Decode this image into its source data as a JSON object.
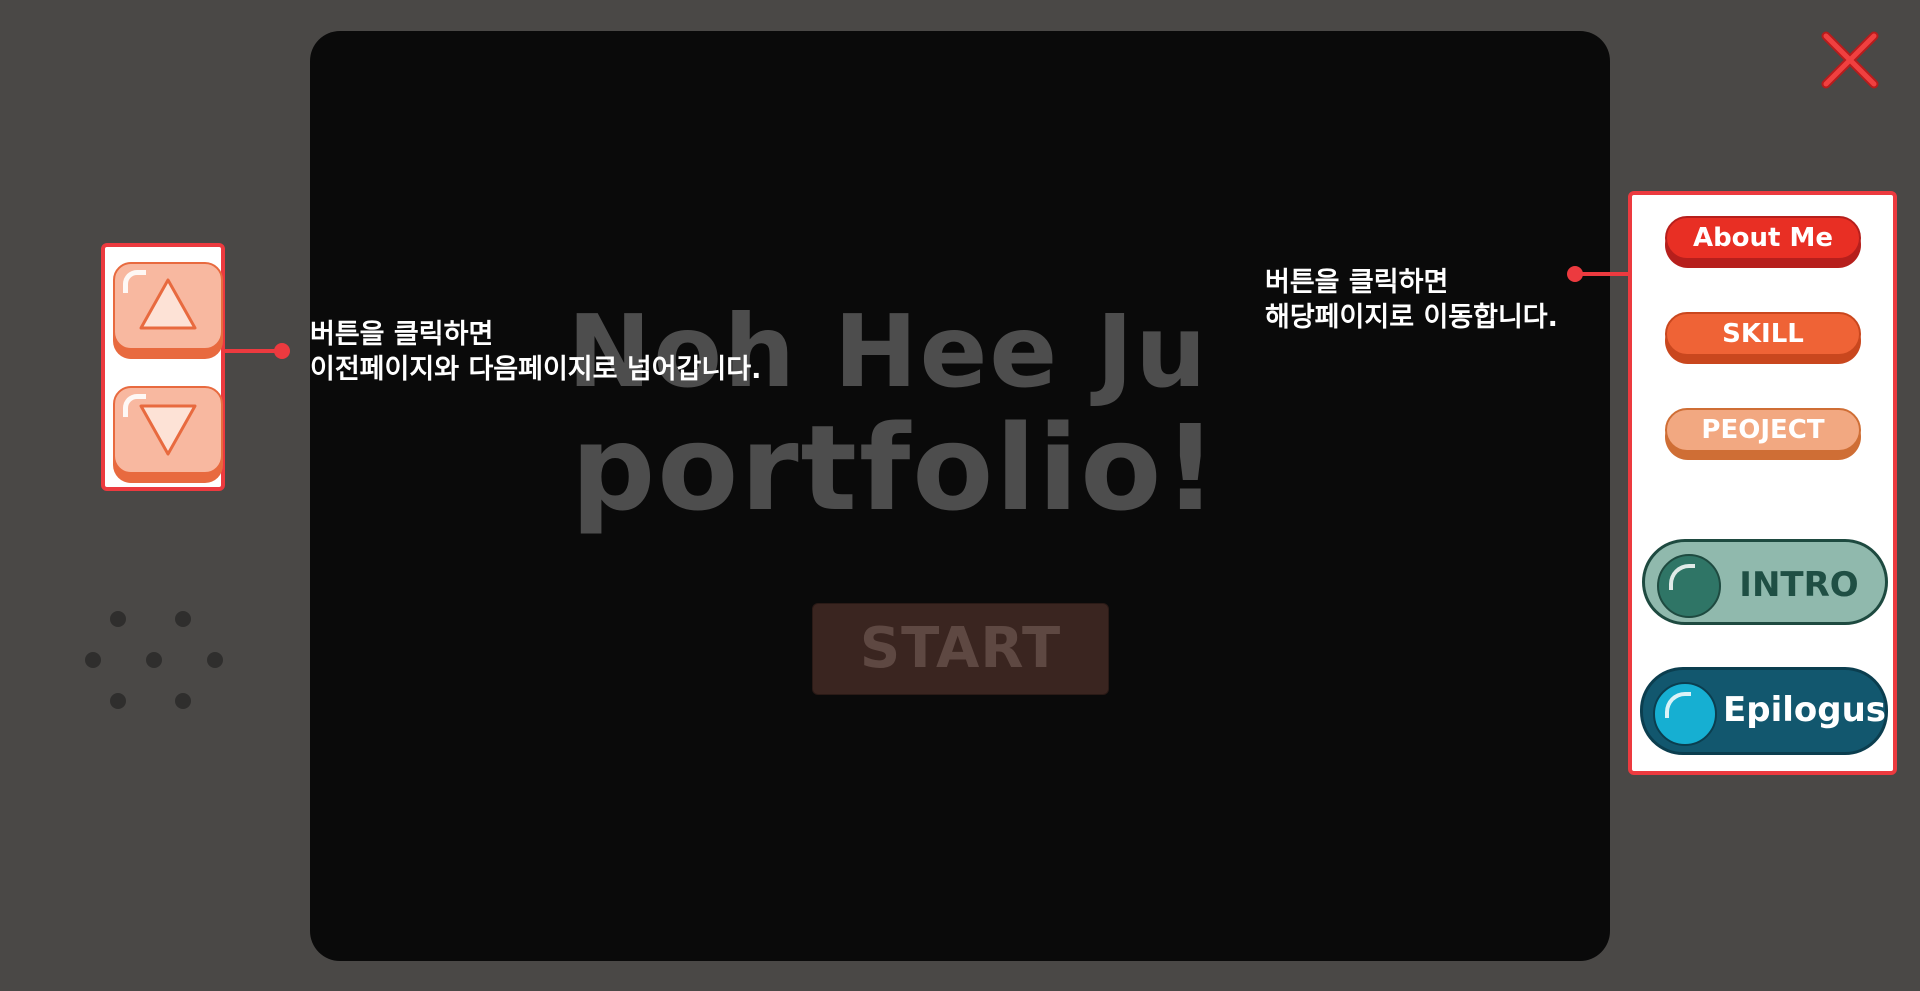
{
  "screen": {
    "title_line1": "Noh Hee Ju",
    "title_line2": "portfolio!",
    "start_label": "START"
  },
  "arrow_panel": {
    "up_icon": "triangle-up-icon",
    "down_icon": "triangle-down-icon"
  },
  "notes": {
    "left": "버튼을 클릭하면\n이전페이지와 다음페이지로 넘어갑니다.",
    "right": "버튼을 클릭하면\n해당페이지로 이동합니다."
  },
  "nav": {
    "about_label": "About Me",
    "skill_label": "SKILL",
    "project_label": "PEOJECT",
    "intro_label": "INTRO",
    "epilogue_label": "Epilogus"
  },
  "colors": {
    "background": "#4a4846",
    "screen": "#0a0a0a",
    "accent_red": "#ec3a3f",
    "about": "#e82f24",
    "skill": "#ef6336",
    "project": "#f2a881",
    "intro": "#90b9ad",
    "epilogue": "#12576e"
  }
}
